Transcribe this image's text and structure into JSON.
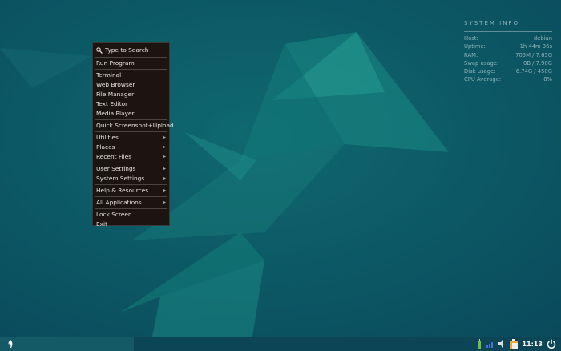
{
  "menu": {
    "search": "Type to Search",
    "groups": [
      [
        "Run Program"
      ],
      [
        "Terminal",
        "Web Browser",
        "File Manager",
        "Text Editor",
        "Media Player"
      ],
      [
        "Quick Screenshot+Upload"
      ],
      [
        "Utilities",
        "Places",
        "Recent Files"
      ],
      [
        "User Settings",
        "System Settings"
      ],
      [
        "Help & Resources"
      ],
      [
        "All Applications"
      ],
      [
        "Lock Screen",
        "Exit"
      ]
    ],
    "submenus": [
      "Utilities",
      "Places",
      "Recent Files",
      "User Settings",
      "System Settings",
      "Help & Resources",
      "All Applications"
    ]
  },
  "sysinfo": {
    "title": "SYSTEM INFO",
    "rows": [
      {
        "k": "Host:",
        "v": "debian"
      },
      {
        "k": "Uptime:",
        "v": "1h 44m 36s"
      },
      {
        "k": "RAM:",
        "v": "705M / 7.65G"
      },
      {
        "k": "Swap usage:",
        "v": "0B / 7.90G"
      },
      {
        "k": "Disk usage:",
        "v": "6.74G / 450G"
      },
      {
        "k": "CPU Average:",
        "v": "8%"
      }
    ]
  },
  "taskbar": {
    "clock": "11:13"
  }
}
